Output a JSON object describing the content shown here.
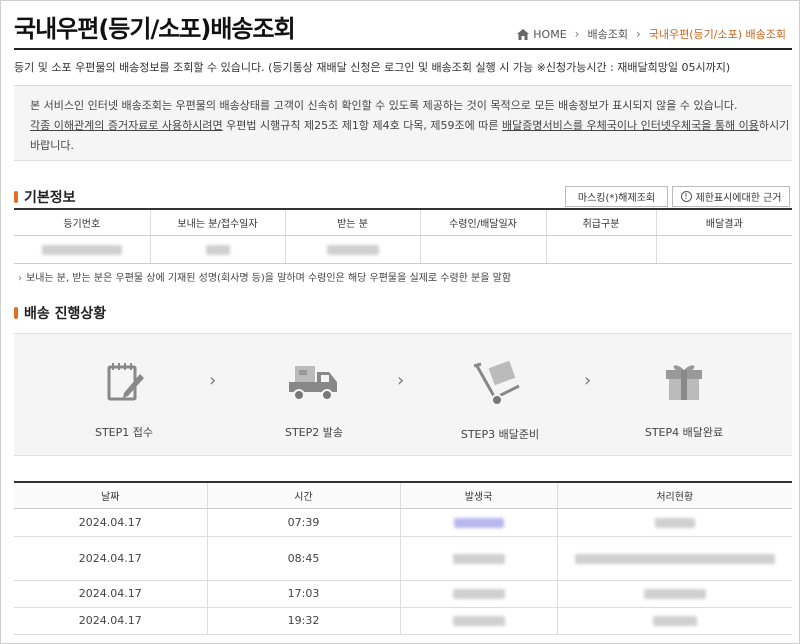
{
  "header": {
    "title": "국내우편(등기/소포)배송조회",
    "breadcrumb": [
      "HOME",
      "배송조회",
      "국내우편(등기/소포) 배송조회"
    ]
  },
  "description": "등기 및 소포 우편물의 배송정보를 조회할 수 있습니다. (등기통상 재배달 신청은 로그인 및 배송조회 실행 시 가능 ※신청가능시간 : 재배달희망일 05시까지)",
  "notice": {
    "line1": "본 서비스인 인터넷 배송조회는 우편물의 배송상태를 고객이 신속히 확인할 수 있도록 제공하는 것이 목적으로 모든 배송정보가 표시되지 않을 수 있습니다.",
    "line2_link1": "각종 이해관계의 증거자료로 사용하시려면",
    "line2_mid": " 우편법 시행규칙 제25조 제1항 제4호 다목, 제59조에 따른 ",
    "line2_link2": "배달증명서비스를 우체국이나 인터넷우체국을 통해 이용",
    "line2_end": "하시기",
    "line3": "바랍니다."
  },
  "basic_info": {
    "heading": "기본정보",
    "masking_button": "마스킹(*)해제조회",
    "restriction_button": "제한표시에대한 근거",
    "columns": [
      "등기번호",
      "보내는 분/접수일자",
      "받는 분",
      "수령인/배달일자",
      "취급구분",
      "배달결과"
    ],
    "note": "보내는 분, 받는 분은 우편물 상에 기재된 성명(회사명 등)을 말하며 수령인은 해당 우편물을 실제로 수령한 분을 말함"
  },
  "progress": {
    "heading": "배송 진행상황",
    "steps": [
      {
        "label": "STEP1 접수",
        "icon": "clipboard-icon"
      },
      {
        "label": "STEP2 발송",
        "icon": "truck-icon"
      },
      {
        "label": "STEP3 배달준비",
        "icon": "hand-cart-icon"
      },
      {
        "label": "STEP4 배달완료",
        "icon": "gift-box-icon"
      }
    ]
  },
  "history": {
    "columns": [
      "날짜",
      "시간",
      "발생국",
      "처리현황"
    ],
    "rows": [
      {
        "date": "2024.04.17",
        "time": "07:39"
      },
      {
        "date": "2024.04.17",
        "time": "08:45"
      },
      {
        "date": "2024.04.17",
        "time": "17:03"
      },
      {
        "date": "2024.04.17",
        "time": "19:32"
      }
    ]
  },
  "colors": {
    "accent": "#c8641c",
    "marker": "#e07020",
    "panel": "#f5f5f5"
  }
}
